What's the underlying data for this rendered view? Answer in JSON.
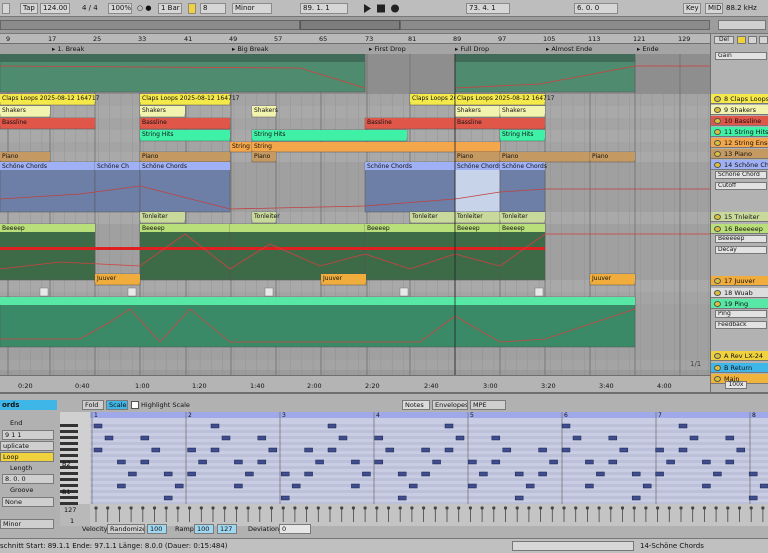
{
  "transport": {
    "tap": "Tap",
    "tempo": "124.00",
    "meter": "4 / 4",
    "zoom": "100%",
    "follow": "○ ●",
    "quantize": "1 Bar",
    "key_count": "8",
    "scale": "Minor",
    "position": "89.  1.  1",
    "loop_start": "73.  4.  1",
    "loop_length": "6.  0.  0",
    "key_label": "Key",
    "midi_label": "MIDI",
    "sample_rate": "88.2 kHz",
    "cpu": "13 %"
  },
  "ruler": {
    "bars": [
      "9",
      "17",
      "25",
      "33",
      "41",
      "49",
      "57",
      "65",
      "73",
      "81",
      "89",
      "97",
      "105",
      "113",
      "121",
      "129"
    ]
  },
  "locators": [
    {
      "label": "1. Break"
    },
    {
      "label": "Big Break"
    },
    {
      "label": "First Drop"
    },
    {
      "label": "Full Drop"
    },
    {
      "label": "Almost Ende"
    },
    {
      "label": "Ende"
    }
  ],
  "timeline": {
    "times": [
      "0:20",
      "0:40",
      "1:00",
      "1:20",
      "1:40",
      "2:00",
      "2:20",
      "2:40",
      "3:00",
      "3:20",
      "3:40",
      "4:00"
    ],
    "page": "1/1"
  },
  "clips": {
    "claps": "Claps Loops 2025-08-12 164717",
    "shakers": "Shakers",
    "bassline": "Bassline",
    "string_hits": "String Hits",
    "string": "String",
    "piano": "Piano",
    "schone": "Schöne Chords",
    "schone_short": "Schöne Ch",
    "tonleiter": "Tonleiter",
    "beeeep": "Beeeep",
    "juuver": "Juuver"
  },
  "tracks": [
    {
      "name": "Gain",
      "color": "#d9c23a"
    },
    {
      "name": "8 Claps Loops",
      "color": "#f5e94a"
    },
    {
      "name": "9 Shakers",
      "color": "#f3f3b0"
    },
    {
      "name": "10 Bassline",
      "color": "#e0574a"
    },
    {
      "name": "11 String Hits",
      "color": "#3ff1a6"
    },
    {
      "name": "12 String Ense",
      "color": "#f4a64a"
    },
    {
      "name": "13 Piano",
      "color": "#c59a62"
    },
    {
      "name": "14 Schöne Chords",
      "color": "#9fb0f5"
    },
    {
      "name": "Schöne Chord",
      "color": "#dddddd"
    },
    {
      "name": "Cutoff",
      "color": "#dddddd"
    },
    {
      "name": "15 Tnleiter",
      "color": "#c9d99b"
    },
    {
      "name": "16 Beeeeep",
      "color": "#b9df7a"
    },
    {
      "name": "Beeeeep",
      "color": "#dddddd"
    },
    {
      "name": "Decay",
      "color": "#dddddd"
    },
    {
      "name": "17 Juuver",
      "color": "#f0ad3c"
    },
    {
      "name": "18 Wuab",
      "color": "#dddddd"
    },
    {
      "name": "19 Ping",
      "color": "#57e8a6"
    },
    {
      "name": "Ping",
      "color": "#dddddd"
    },
    {
      "name": "Feedback",
      "color": "#dddddd"
    },
    {
      "name": "A Rev LX-24",
      "color": "#f0d23c"
    },
    {
      "name": "B Return",
      "color": "#3fb6e8"
    },
    {
      "name": "Main",
      "color": "#f0b43c"
    }
  ],
  "right_top": {
    "del": "Del",
    "main_zoom": "100x"
  },
  "clip_panel": {
    "title": "ords",
    "start_label": "End",
    "end_value": "9   1   1",
    "duplicate": "uplicate",
    "loop": "Loop",
    "length_label": "Length",
    "length_value": "8.  0.  0",
    "groove_label": "Groove",
    "groove_value": "None",
    "scale_value": "Minor"
  },
  "note_editor": {
    "fold": "Fold",
    "scale": "Scale",
    "highlight_scale": "Highlight Scale",
    "tab_notes": "Notes",
    "tab_envelopes": "Envelopes",
    "tab_mpe": "MPE",
    "ruler": [
      "1",
      "2",
      "3",
      "4",
      "5",
      "6",
      "7",
      "8"
    ],
    "pitch_b2": "B2",
    "pitch_b1": "B1",
    "vel_top": "127",
    "vel_bottom": "1"
  },
  "velocity_bar": {
    "velocity_label": "Velocity",
    "randomize": "Randomize",
    "randomize_value": "100",
    "ramp_label": "Ramp",
    "ramp_a": "100",
    "ramp_b": "127",
    "deviation_label": "Deviation",
    "deviation_value": "0"
  },
  "status": {
    "selection": "schnitt   Start: 89.1.1   Ende: 97.1.1   Länge: 8.0.0 (Dauer: 0:15:484)",
    "track": "14-Schöne Chords"
  }
}
